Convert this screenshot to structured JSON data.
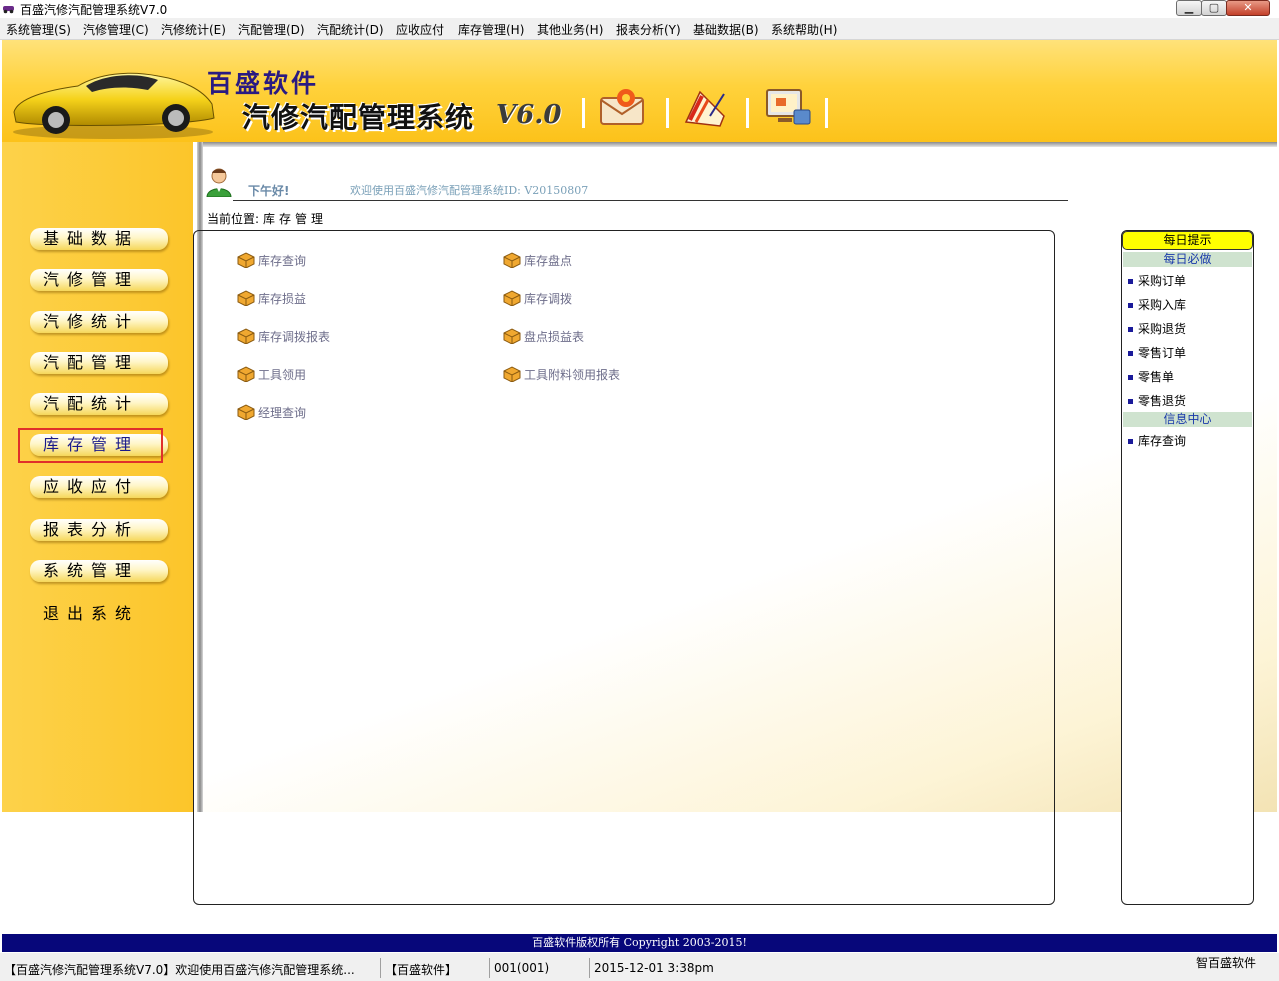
{
  "window": {
    "title": "百盛汽修汽配管理系统V7.0",
    "minimize_label": "▁",
    "maximize_label": "▢",
    "close_label": "✕"
  },
  "menu": [
    {
      "label": "系统管理(S)"
    },
    {
      "label": "汽修管理(C)"
    },
    {
      "label": "汽修统计(E)"
    },
    {
      "label": "汽配管理(D)"
    },
    {
      "label": "汽配统计(D)"
    },
    {
      "label": "应收应付"
    },
    {
      "label": "库存管理(H)"
    },
    {
      "label": "其他业务(H)"
    },
    {
      "label": "报表分析(Y)"
    },
    {
      "label": "基础数据(B)"
    },
    {
      "label": "系统帮助(H)"
    }
  ],
  "banner": {
    "brand": "百盛软件",
    "system_name": "汽修汽配管理系统",
    "version": "V6.0",
    "toolbar_icons": [
      "mail-icon",
      "document-edit-icon",
      "monitor-icon"
    ]
  },
  "sidebar": {
    "items": [
      {
        "label": "基础数据",
        "active": false
      },
      {
        "label": "汽修管理",
        "active": false
      },
      {
        "label": "汽修统计",
        "active": false
      },
      {
        "label": "汽配管理",
        "active": false
      },
      {
        "label": "汽配统计",
        "active": false
      },
      {
        "label": "库存管理",
        "active": true
      },
      {
        "label": "应收应付",
        "active": false
      },
      {
        "label": "报表分析",
        "active": false
      },
      {
        "label": "系统管理",
        "active": false
      }
    ],
    "exit_label": "退出系统"
  },
  "header": {
    "greeting": "下午好!",
    "welcome": "欢迎使用百盛汽修汽配管理系统ID: V20150807",
    "location_label": "当前位置:",
    "location_value": "库存管理"
  },
  "functions": [
    {
      "label": "库存查询"
    },
    {
      "label": "库存盘点"
    },
    {
      "label": "库存损益"
    },
    {
      "label": "库存调拨"
    },
    {
      "label": "库存调拨报表"
    },
    {
      "label": "盘点损益表"
    },
    {
      "label": "工具领用"
    },
    {
      "label": "工具附料领用报表"
    },
    {
      "label": "经理查询"
    }
  ],
  "tips": {
    "header": "每日提示",
    "daily_title": "每日必做",
    "daily_items": [
      "采购订单",
      "采购入库",
      "采购退货",
      "零售订单",
      "零售单",
      "零售退货"
    ],
    "info_title": "信息中心",
    "info_items": [
      "库存查询"
    ]
  },
  "footer": {
    "copyright": "百盛软件版权所有 Copyright 2003-2015!"
  },
  "statusbar": {
    "message": "【百盛汽修汽配管理系统V7.0】欢迎使用百盛汽修汽配管理系统...",
    "company": "【百盛软件】",
    "user": "001(001)",
    "datetime": "2015-12-01 3:38pm",
    "brand": "智百盛软件"
  },
  "colors": {
    "banner_yellow": "#fcc21a",
    "copyright_bar": "#07077a",
    "highlight": "#e0302a",
    "tips_header": "#ffff00"
  }
}
